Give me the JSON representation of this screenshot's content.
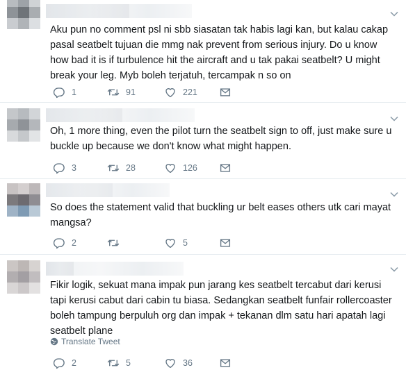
{
  "tweets": [
    {
      "text": "Aku pun no comment psl ni sbb siasatan tak habis lagi kan, but kalau cakap pasal seatbelt tujuan die mmg nak prevent from serious injury. Do u know how bad it is if turbulence hit the aircraft and u tak pakai seatbelt? U might break your leg. Myb boleh terjatuh, tercampak n so on",
      "replies": "1",
      "retweets": "91",
      "likes": "221"
    },
    {
      "text": "Oh, 1 more thing, even the pilot turn the seatbelt sign to off, just make sure u buckle up because we don't know what might happen.",
      "replies": "3",
      "retweets": "28",
      "likes": "126"
    },
    {
      "text": "So does the statement valid that buckling ur belt eases others utk cari mayat mangsa?",
      "replies": "2",
      "retweets": "",
      "likes": "5"
    },
    {
      "text": "Fikir logik, sekuat mana impak pun jarang kes seatbelt tercabut dari kerusi tapi kerusi cabut dari cabin tu biasa. Sedangkan seatbelt funfair rollercoaster boleh tampung berpuluh org dan impak + tekanan dlm satu hari apatah lagi seatbelt plane",
      "translate": "Translate Tweet",
      "replies": "2",
      "retweets": "5",
      "likes": "36"
    }
  ],
  "icons": {
    "reply": "reply-icon",
    "retweet": "retweet-icon",
    "like": "like-icon",
    "dm": "direct-message-icon",
    "caret": "chevron-down-icon",
    "globe": "globe-icon"
  },
  "colors": {
    "text": "#14171a",
    "muted": "#657786",
    "divider": "#e6ecf0"
  }
}
